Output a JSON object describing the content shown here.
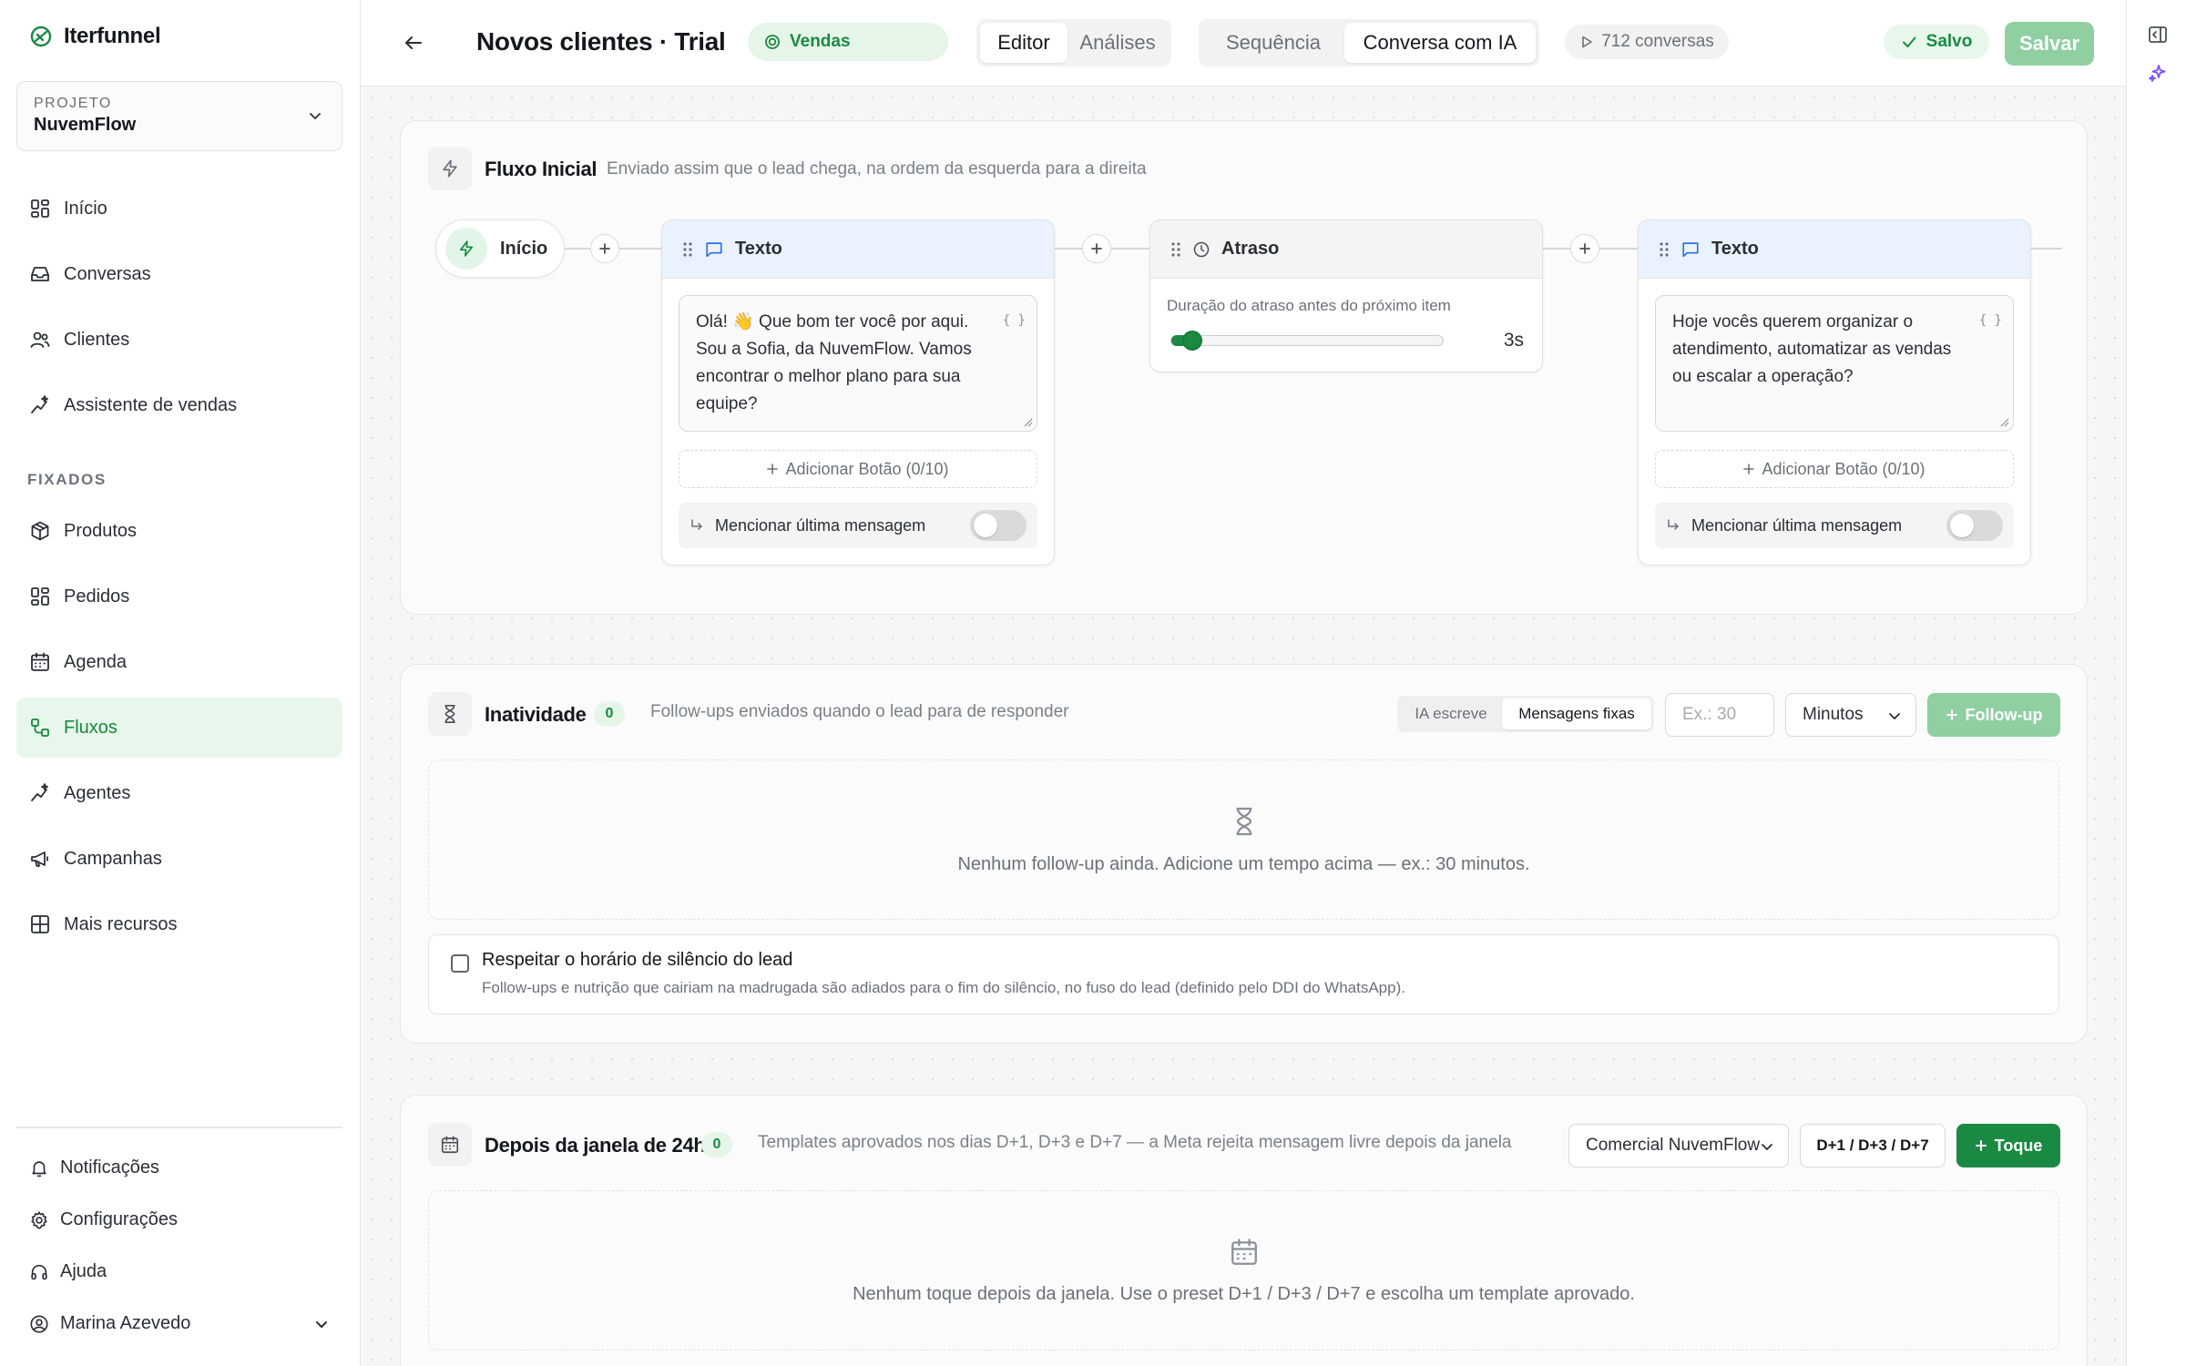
{
  "brand": {
    "name": "Iterfunnel"
  },
  "project": {
    "label": "PROJETO",
    "name": "NuvemFlow"
  },
  "nav": {
    "items": [
      {
        "label": "Início"
      },
      {
        "label": "Conversas"
      },
      {
        "label": "Clientes"
      },
      {
        "label": "Assistente de vendas"
      }
    ],
    "pinned_title": "FIXADOS",
    "pinned": [
      {
        "label": "Produtos"
      },
      {
        "label": "Pedidos"
      },
      {
        "label": "Agenda"
      },
      {
        "label": "Fluxos",
        "active": true
      },
      {
        "label": "Agentes"
      },
      {
        "label": "Campanhas"
      },
      {
        "label": "Mais recursos"
      }
    ],
    "bottom": [
      {
        "label": "Notificações"
      },
      {
        "label": "Configurações"
      },
      {
        "label": "Ajuda"
      }
    ],
    "user": "Marina Azevedo"
  },
  "header": {
    "title": "Novos clientes · Trial",
    "channel_badge": "Vendas",
    "view_tabs": [
      {
        "label": "Editor",
        "active": true
      },
      {
        "label": "Análises"
      }
    ],
    "mode_tabs": [
      {
        "label": "Sequência"
      },
      {
        "label": "Conversa com IA",
        "active": true
      }
    ],
    "conversations": "712 conversas",
    "saved_status": "Salvo",
    "save_label": "Salvar"
  },
  "initial_flow": {
    "title": "Fluxo Inicial",
    "subtitle": "Enviado assim que o lead chega, na ordem da esquerda para a direita",
    "start_label": "Início",
    "nodes": [
      {
        "type": "Texto",
        "message": "Olá! 👋 Que bom ter você por aqui. Sou a Sofia, da NuvemFlow. Vamos encontrar o melhor plano para sua equipe?",
        "var_chip": "{ }",
        "add_button": "Adicionar Botão (0/10)",
        "mention_label": "Mencionar última mensagem",
        "mention_enabled": false
      },
      {
        "type": "Atraso",
        "delay_label": "Duração do atraso antes do próximo item",
        "delay_value": "3s",
        "delay_fraction": 0.04
      },
      {
        "type": "Texto",
        "message": "Hoje vocês querem organizar o atendimento, automatizar as vendas ou escalar a operação?",
        "var_chip": "{ }",
        "add_button": "Adicionar Botão (0/10)",
        "mention_label": "Mencionar última mensagem",
        "mention_enabled": false
      }
    ]
  },
  "inactivity": {
    "title": "Inatividade",
    "count": "0",
    "subtitle": "Follow-ups enviados quando o lead para de responder",
    "mode_options": [
      {
        "label": "IA escreve"
      },
      {
        "label": "Mensagens fixas",
        "active": true
      }
    ],
    "time_placeholder": "Ex.: 30",
    "unit": "Minutos",
    "add_label": "Follow-up",
    "empty_text": "Nenhum follow-up ainda. Adicione um tempo acima — ex.: 30 minutos.",
    "silence_title": "Respeitar o horário de silêncio do lead",
    "silence_sub": "Follow-ups e nutrição que cairiam na madrugada são adiados para o fim do silêncio, no fuso do lead (definido pelo DDI do WhatsApp).",
    "silence_checked": false
  },
  "after_window": {
    "title": "Depois da janela de 24h",
    "count": "0",
    "subtitle": "Templates aprovados nos dias D+1, D+3 e D+7 — a Meta rejeita mensagem livre depois da janela",
    "template_select": "Comercial NuvemFlow",
    "preset_label": "D+1 / D+3 / D+7",
    "add_label": "Toque",
    "empty_text": "Nenhum toque depois da janela. Use o preset D+1 / D+3 / D+7 e escolha um template aprovado."
  },
  "colors": {
    "accent": "#1a8a42",
    "accent_soft": "#e5f6e9",
    "accent_disabled": "#8fcfa2",
    "blue_head": "#e9f2fe"
  }
}
